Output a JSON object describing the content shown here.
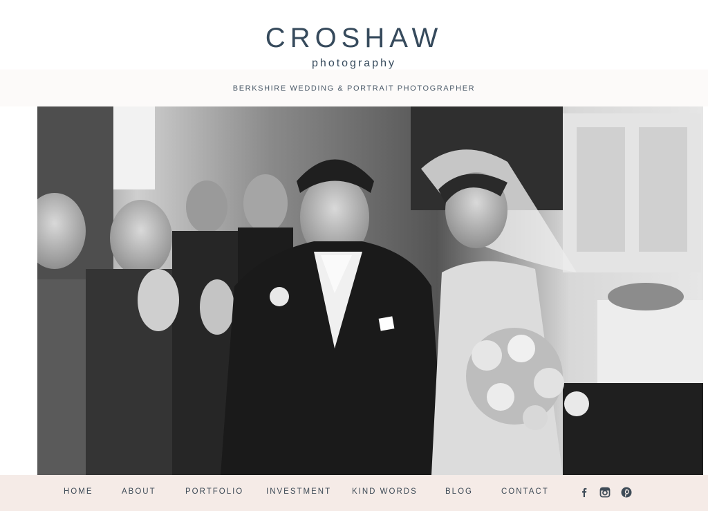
{
  "header": {
    "brand_name": "CROSHAW",
    "brand_sub": "photography",
    "tagline": "BERKSHIRE WEDDING & PORTRAIT PHOTOGRAPHER"
  },
  "hero": {
    "description_icon": "wedding-photo"
  },
  "nav": {
    "items": [
      {
        "label": "HOME"
      },
      {
        "label": "ABOUT"
      },
      {
        "label": "PORTFOLIO"
      },
      {
        "label": "INVESTMENT"
      },
      {
        "label": "KIND WORDS"
      },
      {
        "label": "BLOG"
      },
      {
        "label": "CONTACT"
      }
    ],
    "social": [
      {
        "icon": "facebook-icon"
      },
      {
        "icon": "instagram-icon"
      },
      {
        "icon": "pinterest-icon"
      }
    ]
  },
  "colors": {
    "brand": "#364a5c",
    "nav_bg": "#f5ebe7",
    "nav_text": "#3e4b57"
  }
}
